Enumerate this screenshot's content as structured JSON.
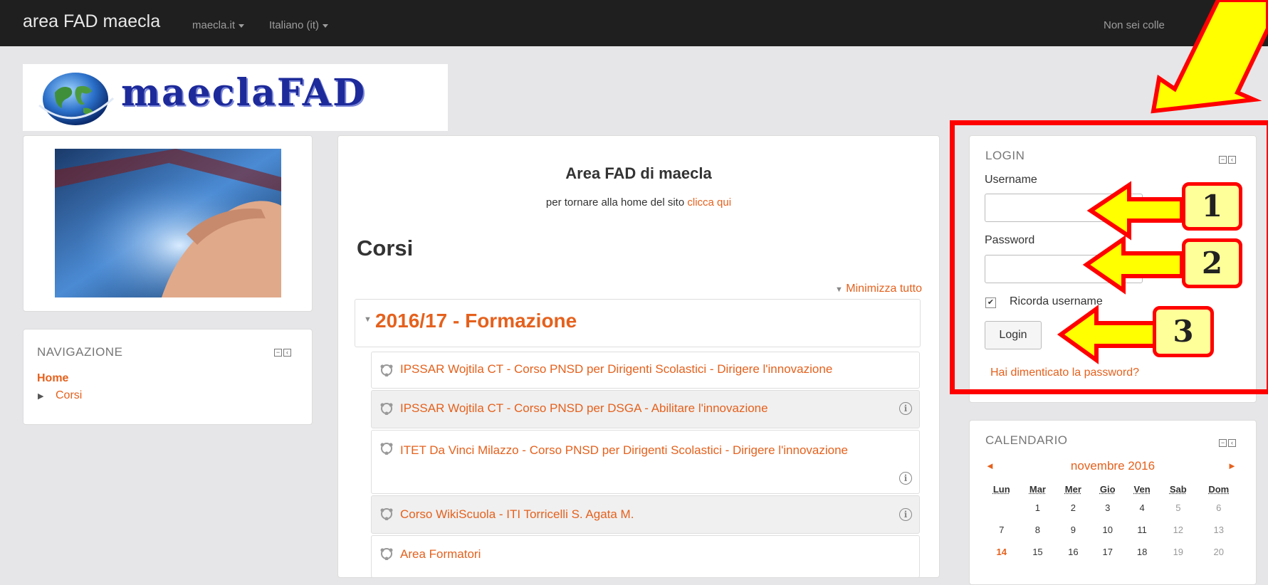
{
  "navbar": {
    "brand": "area FAD maecla",
    "menu_site": "maecla.it",
    "menu_lang": "Italiano (it)",
    "login_status_visible": "Non sei colle",
    "login_status_end": ")"
  },
  "logo": {
    "text": "maeclaFAD"
  },
  "navigation": {
    "title": "NAVIGAZIONE",
    "home": "Home",
    "courses": "Corsi"
  },
  "main": {
    "title": "Area  FAD di maecla",
    "subtitle_text": "per tornare alla home del sito ",
    "subtitle_link": "clicca qui",
    "heading": "Corsi",
    "collapse_all": "Minimizza tutto",
    "category": "2016/17 - Formazione",
    "courses": [
      {
        "name": "IPSSAR Wojtila CT - Corso PNSD per Dirigenti Scolastici - Dirigere l'innovazione",
        "info": false
      },
      {
        "name": "IPSSAR Wojtila CT - Corso PNSD per DSGA - Abilitare l'innovazione",
        "info": true
      },
      {
        "name": "ITET Da Vinci Milazzo - Corso PNSD per Dirigenti Scolastici - Dirigere l'innovazione",
        "info": true
      },
      {
        "name": "Corso WikiScuola - ITI Torricelli S. Agata M.",
        "info": true
      },
      {
        "name": "Area Formatori",
        "info": false
      }
    ]
  },
  "login": {
    "title": "LOGIN",
    "username_label": "Username",
    "username_value": "",
    "password_label": "Password",
    "password_value": "",
    "remember_label": "Ricorda username",
    "remember_checked": true,
    "login_button": "Login",
    "forgot_link": "Hai dimenticato la password?"
  },
  "annotations": {
    "callouts": [
      "1",
      "2",
      "3"
    ],
    "highlight_color": "#ff0000",
    "arrow_color": "#ffff00"
  },
  "calendar": {
    "title": "CALENDARIO",
    "month": "novembre 2016",
    "prev": "◄",
    "next": "►",
    "weekdays": [
      "Lun",
      "Mar",
      "Mer",
      "Gio",
      "Ven",
      "Sab",
      "Dom"
    ],
    "weeks": [
      [
        "",
        "1",
        "2",
        "3",
        "4",
        "5",
        "6"
      ],
      [
        "7",
        "8",
        "9",
        "10",
        "11",
        "12",
        "13"
      ],
      [
        "14",
        "15",
        "16",
        "17",
        "18",
        "19",
        "20"
      ]
    ],
    "today": "14"
  },
  "colors": {
    "accent": "#e5611d",
    "navbar": "#1f1f1f",
    "logo_blue": "#1d2a9a"
  }
}
